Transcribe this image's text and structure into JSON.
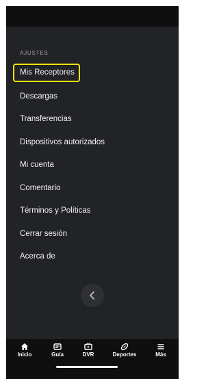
{
  "settings": {
    "section_title": "AJUSTES",
    "items": [
      {
        "label": "Mis Receptores",
        "selected": true
      },
      {
        "label": "Descargas"
      },
      {
        "label": "Transferencias"
      },
      {
        "label": "Dispositivos autorizados"
      },
      {
        "label": "Mi cuenta"
      },
      {
        "label": "Comentario"
      },
      {
        "label": "Términos y Políticas"
      },
      {
        "label": "Cerrar sesión"
      },
      {
        "label": "Acerca de"
      }
    ],
    "collapse_icon": "chevron-left-icon"
  },
  "tabbar": {
    "tabs": [
      {
        "label": "Inicio",
        "icon": "home-icon"
      },
      {
        "label": "Guía",
        "icon": "guide-icon"
      },
      {
        "label": "DVR",
        "icon": "tv-icon"
      },
      {
        "label": "Deportes",
        "icon": "football-icon"
      },
      {
        "label": "Más",
        "icon": "menu-icon"
      }
    ]
  },
  "colors": {
    "background": "#222326",
    "bars": "#0f0f10",
    "highlight": "#f7e400",
    "text": "#f2f2f2",
    "section_title": "#a6a6aa"
  }
}
